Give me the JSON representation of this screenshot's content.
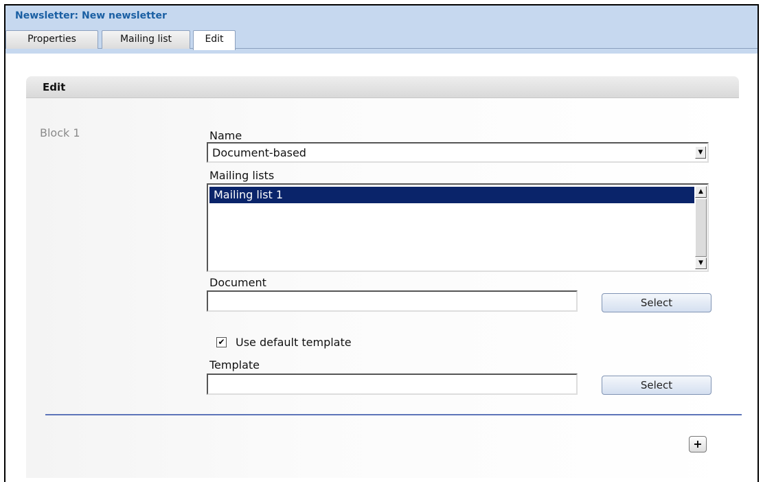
{
  "window": {
    "title": "Newsletter: New newsletter"
  },
  "tabs": [
    {
      "label": "Properties",
      "active": false
    },
    {
      "label": "Mailing list",
      "active": false
    },
    {
      "label": "Edit",
      "active": true
    }
  ],
  "panel": {
    "header": "Edit"
  },
  "block": {
    "label": "Block 1",
    "name_label": "Name",
    "name_value": "Document-based",
    "mailing_lists_label": "Mailing lists",
    "mailing_lists": [
      "Mailing list 1"
    ],
    "document_label": "Document",
    "document_value": "",
    "document_select": "Select",
    "use_default_template_label": "Use default template",
    "use_default_template_checked": true,
    "template_label": "Template",
    "template_value": "",
    "template_select": "Select",
    "add_button": "+"
  },
  "icons": {
    "dropdown": "chevron-down-icon",
    "scroll_up": "arrow-up-icon",
    "scroll_down": "arrow-down-icon",
    "check": "checkmark-icon",
    "add": "plus-icon"
  },
  "colors": {
    "title": "#1a5fa3",
    "title_bar": "#c6d8ef",
    "selection": "#0a246a",
    "divider": "#5c74b8"
  }
}
